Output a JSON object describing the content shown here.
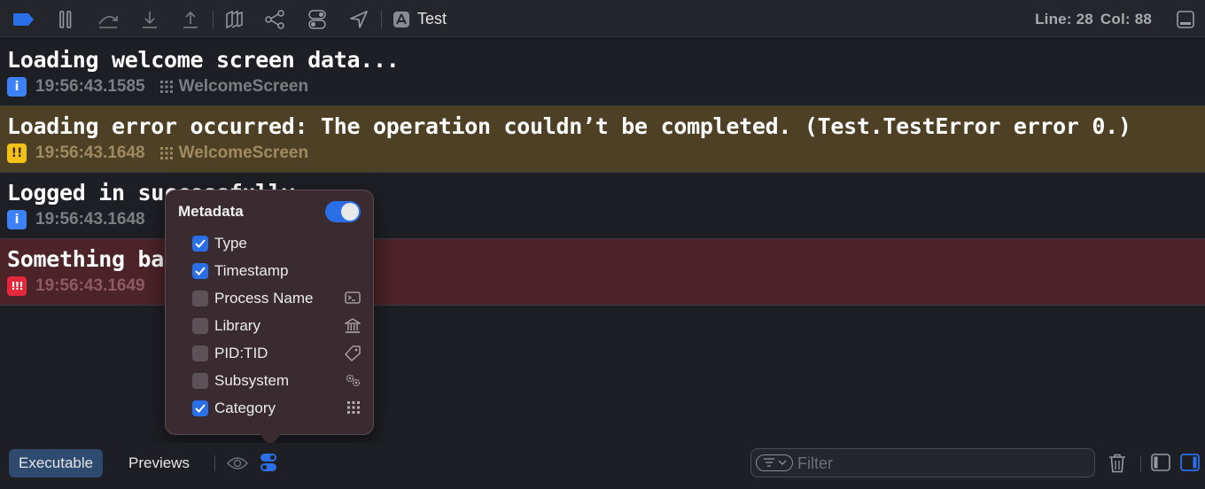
{
  "toolbar": {
    "target_label": "Test",
    "line_label": "Line: 28",
    "col_label": "Col: 88",
    "accent": "#2a6ee8",
    "icons": [
      "breakpoint-toggle-icon",
      "pause-icon",
      "step-over-icon",
      "step-into-icon",
      "step-out-icon",
      "debug-view-hierarchy-icon",
      "memory-graph-icon",
      "environment-overrides-icon",
      "location-icon",
      "app-target-icon",
      "hide-console-icon"
    ]
  },
  "log_entries": [
    {
      "level": "info",
      "message": "Loading welcome screen data...",
      "timestamp": "19:56:43.1585",
      "category": "WelcomeScreen"
    },
    {
      "level": "warning",
      "message": "Loading error occurred: The operation couldn’t be completed. (Test.TestError error 0.)",
      "timestamp": "19:56:43.1648",
      "category": "WelcomeScreen"
    },
    {
      "level": "info",
      "message": "Logged in successfully",
      "timestamp": "19:56:43.1648",
      "category": ""
    },
    {
      "level": "error",
      "message": "Something ba",
      "timestamp": "19:56:43.1649",
      "category": ""
    }
  ],
  "badges": {
    "info": "i",
    "warning": "!!",
    "error": "!!!"
  },
  "metadata_popover": {
    "title": "Metadata",
    "enabled": true,
    "options": [
      {
        "label": "Type",
        "checked": true,
        "icon": ""
      },
      {
        "label": "Timestamp",
        "checked": true,
        "icon": ""
      },
      {
        "label": "Process Name",
        "checked": false,
        "icon": "terminal-icon"
      },
      {
        "label": "Library",
        "checked": false,
        "icon": "library-icon"
      },
      {
        "label": "PID:TID",
        "checked": false,
        "icon": "tag-icon"
      },
      {
        "label": "Subsystem",
        "checked": false,
        "icon": "subsystem-gears-icon"
      },
      {
        "label": "Category",
        "checked": true,
        "icon": "category-grid-icon"
      }
    ]
  },
  "bottom_bar": {
    "tabs": [
      {
        "label": "Executable",
        "active": true
      },
      {
        "label": "Previews",
        "active": false
      }
    ],
    "filter_placeholder": "Filter"
  }
}
